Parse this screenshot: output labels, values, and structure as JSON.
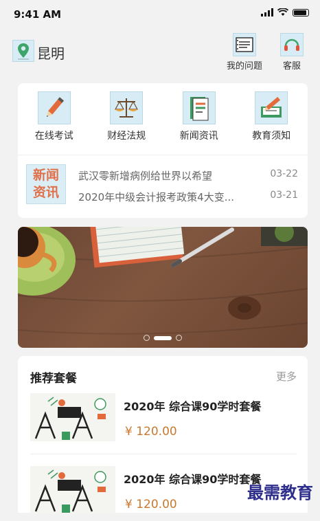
{
  "status": {
    "time": "9:41 AM"
  },
  "header": {
    "city": "昆明",
    "my_questions": "我的问题",
    "customer_service": "客服"
  },
  "quick_links": [
    {
      "label": "在线考试",
      "icon": "pencil-icon"
    },
    {
      "label": "财经法规",
      "icon": "scale-icon"
    },
    {
      "label": "新闻资讯",
      "icon": "books-icon"
    },
    {
      "label": "教育须知",
      "icon": "notebook-pen-icon"
    }
  ],
  "news": {
    "logo": "新闻资讯",
    "logo_line1": "新闻",
    "logo_line2": "资讯",
    "items": [
      {
        "title": "武汉零新增病例给世界以希望",
        "date": "03-22"
      },
      {
        "title": "2020年中级会计报考政策4大变...",
        "date": "03-21"
      }
    ]
  },
  "banner": {
    "slides": 3,
    "active_slide": 2
  },
  "recommend": {
    "title": "推荐套餐",
    "more": "更多",
    "packages": [
      {
        "name": "2020年 综合课90学时套餐",
        "price": "¥  120.00"
      },
      {
        "name": "2020年 综合课90学时套餐",
        "price": "¥  120.00"
      }
    ]
  },
  "watermark": "最需教育",
  "colors": {
    "accent": "#c9782f",
    "icon_bg": "#d7ecf5",
    "news_logo": "#e0704a"
  }
}
